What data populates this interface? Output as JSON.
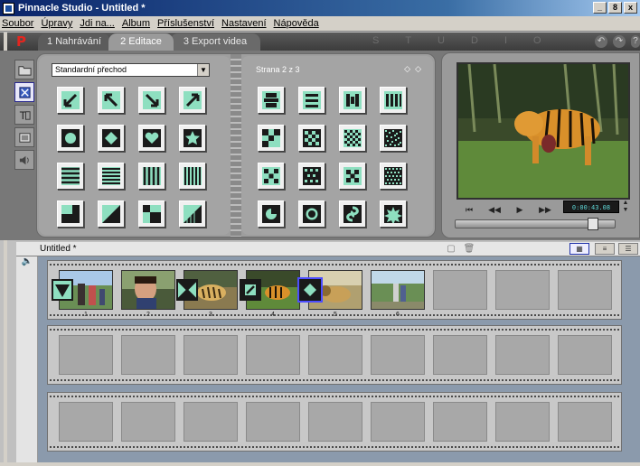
{
  "window": {
    "title": "Pinnacle Studio - Untitled *",
    "buttons": [
      "_",
      "8",
      "x"
    ]
  },
  "menu": [
    "Soubor",
    "Úpravy",
    "Jdi na...",
    "Album",
    "Příslušenství",
    "Nastavení",
    "Nápověda"
  ],
  "modes": {
    "logo": "P",
    "tabs": [
      {
        "label": "1 Nahrávání"
      },
      {
        "label": "2 Editace"
      },
      {
        "label": "3 Export videa"
      }
    ],
    "studio": "STUDIO",
    "undo": "↶",
    "redo": "↷",
    "help": "?"
  },
  "album": {
    "selector_value": "Standardní přechod",
    "page_indicator": "Strana 2 z 3",
    "nav": "◇◇",
    "tools": [
      "folder-video-icon",
      "transitions-icon",
      "titles-icon",
      "photos-icon",
      "sound-icon"
    ]
  },
  "player": {
    "counter": "0:00:43.08",
    "controls": [
      "⏮",
      "◀◀",
      "▶",
      "▶▶"
    ],
    "scrub_position": 0.88
  },
  "storyboard": {
    "title": "Untitled *",
    "left_icons": [
      "📁",
      "🔈"
    ],
    "view_buttons": [
      "▦",
      "≡",
      "☰"
    ],
    "clips": [
      {
        "num": "1"
      },
      {
        "num": "2"
      },
      {
        "num": "3"
      },
      {
        "num": "4"
      },
      {
        "num": "5"
      },
      {
        "num": "6"
      }
    ]
  },
  "colors": {
    "accent": "#8edfc0",
    "selection": "#4d4dff",
    "timeline_bg": "#8b9aac",
    "logo": "#e3261f"
  }
}
